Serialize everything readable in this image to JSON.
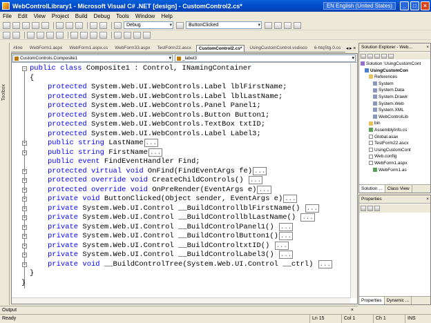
{
  "window": {
    "title": "WebControlLibrary1 - Microsoft Visual C# .NET [design] - CustomControl2.cs*",
    "language": "EN English (United States)"
  },
  "menu": [
    "File",
    "Edit",
    "View",
    "Project",
    "Build",
    "Debug",
    "Tools",
    "Window",
    "Help"
  ],
  "toolbar": {
    "config": "Debug",
    "find": "ButtonClicked"
  },
  "toolbox_label": "Toolbox",
  "editor_tabs": [
    {
      "label": "#line",
      "active": false
    },
    {
      "label": "WebForm1.aspx",
      "active": false
    },
    {
      "label": "WebForm1.aspx.cs",
      "active": false
    },
    {
      "label": "WebForm33.aspx",
      "active": false
    },
    {
      "label": "TestForm22.ascx",
      "active": false
    },
    {
      "label": "CustomControl2.cs*",
      "active": true
    },
    {
      "label": "UsingCustomControl.vsdisco",
      "active": false
    },
    {
      "label": "6-htqStg.0.cs",
      "active": false
    }
  ],
  "navbar": {
    "class_dd": "CustomControls.Composite1",
    "member_dd": "_label3"
  },
  "code": [
    {
      "indent": 0,
      "box": "-",
      "parts": [
        [
          "kw",
          "public class"
        ],
        [
          "t",
          " Composite1 : Control, INamingContainer"
        ]
      ]
    },
    {
      "indent": 0,
      "box": "",
      "parts": [
        [
          "t",
          "{"
        ]
      ]
    },
    {
      "indent": 1,
      "box": "",
      "parts": [
        [
          "kw",
          "protected"
        ],
        [
          "t",
          " System.Web.UI.WebControls.Label lblFirstName;"
        ]
      ]
    },
    {
      "indent": 1,
      "box": "",
      "parts": [
        [
          "kw",
          "protected"
        ],
        [
          "t",
          " System.Web.UI.WebControls.Label lblLastName;"
        ]
      ]
    },
    {
      "indent": 1,
      "box": "",
      "parts": [
        [
          "kw",
          "protected"
        ],
        [
          "t",
          " System.Web.UI.WebControls.Panel Panel1;"
        ]
      ]
    },
    {
      "indent": 1,
      "box": "",
      "parts": [
        [
          "kw",
          "protected"
        ],
        [
          "t",
          " System.Web.UI.WebControls.Button Button1;"
        ]
      ]
    },
    {
      "indent": 1,
      "box": "",
      "parts": [
        [
          "kw",
          "protected"
        ],
        [
          "t",
          " System.Web.UI.WebControls.TextBox txtID;"
        ]
      ]
    },
    {
      "indent": 1,
      "box": "",
      "parts": [
        [
          "kw",
          "protected"
        ],
        [
          "t",
          " System.Web.UI.WebControls.Label Label3;"
        ]
      ]
    },
    {
      "indent": 1,
      "box": "+",
      "parts": [
        [
          "kw",
          "public string"
        ],
        [
          "t",
          " LastName"
        ],
        [
          "c",
          "..."
        ]
      ]
    },
    {
      "indent": 1,
      "box": "+",
      "parts": [
        [
          "kw",
          "public string"
        ],
        [
          "t",
          " FirstName"
        ],
        [
          "c",
          "..."
        ]
      ]
    },
    {
      "indent": 1,
      "box": "",
      "parts": [
        [
          "kw",
          "public event"
        ],
        [
          "t",
          " FindEventHandler Find;"
        ]
      ]
    },
    {
      "indent": 1,
      "box": "+",
      "parts": [
        [
          "kw",
          "protected virtual void"
        ],
        [
          "t",
          " OnFind(FindEventArgs fe)"
        ],
        [
          "c",
          "..."
        ]
      ]
    },
    {
      "indent": 1,
      "box": "+",
      "parts": [
        [
          "kw",
          "protected override void"
        ],
        [
          "t",
          " CreateChildControls() "
        ],
        [
          "c",
          "..."
        ]
      ]
    },
    {
      "indent": 1,
      "box": "+",
      "parts": [
        [
          "kw",
          "protected override void"
        ],
        [
          "t",
          " OnPreRender(EventArgs e)"
        ],
        [
          "c",
          "..."
        ]
      ]
    },
    {
      "indent": 1,
      "box": "+",
      "parts": [
        [
          "kw",
          "private void"
        ],
        [
          "t",
          " ButtonClicked(Object sender, EventArgs e)"
        ],
        [
          "c",
          "..."
        ]
      ]
    },
    {
      "indent": 1,
      "box": "+",
      "parts": [
        [
          "kw",
          "private"
        ],
        [
          "t",
          " System.Web.UI.Control __BuildControllblFirstName() "
        ],
        [
          "c",
          "..."
        ]
      ]
    },
    {
      "indent": 1,
      "box": "+",
      "parts": [
        [
          "kw",
          "private"
        ],
        [
          "t",
          " System.Web.UI.Control __BuildControllblLastName() "
        ],
        [
          "c",
          "..."
        ]
      ]
    },
    {
      "indent": 1,
      "box": "+",
      "parts": [
        [
          "kw",
          "private"
        ],
        [
          "t",
          " System.Web.UI.Control __BuildControlPanel1() "
        ],
        [
          "c",
          "..."
        ]
      ]
    },
    {
      "indent": 1,
      "box": "+",
      "parts": [
        [
          "kw",
          "private"
        ],
        [
          "t",
          " System.Web.UI.Control __BuildControlButton1()"
        ],
        [
          "c",
          "..."
        ]
      ]
    },
    {
      "indent": 1,
      "box": "+",
      "parts": [
        [
          "kw",
          "private"
        ],
        [
          "t",
          " System.Web.UI.Control __BuildControltxtID() "
        ],
        [
          "c",
          "..."
        ]
      ]
    },
    {
      "indent": 1,
      "box": "+",
      "parts": [
        [
          "kw",
          "private"
        ],
        [
          "t",
          " System.Web.UI.Control __BuildControlLabel3() "
        ],
        [
          "c",
          "..."
        ]
      ]
    },
    {
      "indent": 1,
      "box": "+",
      "parts": [
        [
          "kw",
          "private void"
        ],
        [
          "t",
          " __BuildControlTree(System.Web.UI.Control __ctrl) "
        ],
        [
          "c",
          "..."
        ]
      ]
    },
    {
      "indent": 0,
      "box": "",
      "parts": [
        [
          "t",
          "}"
        ]
      ]
    },
    {
      "indent": -1,
      "box": "",
      "parts": [
        [
          "t",
          "}"
        ]
      ]
    }
  ],
  "solution_explorer": {
    "title": "Solution Explorer - Web...",
    "items": [
      {
        "label": "Solution 'UsingCustomCont",
        "icon": "sol",
        "level": 0,
        "bold": false
      },
      {
        "label": "UsingCustomCon",
        "icon": "proj",
        "level": 1,
        "bold": true
      },
      {
        "label": "References",
        "icon": "folder",
        "level": 2,
        "bold": false
      },
      {
        "label": "System",
        "icon": "ref",
        "level": 3,
        "bold": false
      },
      {
        "label": "System.Data",
        "icon": "ref",
        "level": 3,
        "bold": false
      },
      {
        "label": "System.Drawir",
        "icon": "ref",
        "level": 3,
        "bold": false
      },
      {
        "label": "System.Web",
        "icon": "ref",
        "level": 3,
        "bold": false
      },
      {
        "label": "System.XML",
        "icon": "ref",
        "level": 3,
        "bold": false
      },
      {
        "label": "WebControlLib",
        "icon": "ref",
        "level": 3,
        "bold": false
      },
      {
        "label": "bin",
        "icon": "folder",
        "level": 2,
        "bold": false
      },
      {
        "label": "AssemblyInfo.cs",
        "icon": "cs",
        "level": 2,
        "bold": false
      },
      {
        "label": "Global.asax",
        "icon": "page",
        "level": 2,
        "bold": false
      },
      {
        "label": "TestForm22.ascx",
        "icon": "page",
        "level": 2,
        "bold": false
      },
      {
        "label": "UsingCustomCont",
        "icon": "page",
        "level": 2,
        "bold": false
      },
      {
        "label": "Web.config",
        "icon": "page",
        "level": 2,
        "bold": false
      },
      {
        "label": "WebForm1.aspx",
        "icon": "page",
        "level": 2,
        "bold": false
      },
      {
        "label": "WebForm1.as",
        "icon": "cs",
        "level": 3,
        "bold": false
      }
    ],
    "tabs": [
      "Solution ...",
      "Class View"
    ]
  },
  "properties": {
    "title": "Properties",
    "tabs": [
      "Properties",
      "Dynamic ..."
    ]
  },
  "output": {
    "label": "Output"
  },
  "status": {
    "ready": "Ready",
    "ln": "Ln 15",
    "col": "Col 1",
    "ch": "Ch 1",
    "mode": "INS"
  }
}
